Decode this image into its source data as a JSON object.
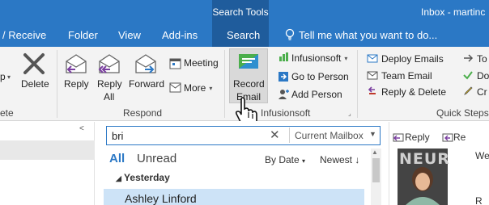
{
  "titlebar": {
    "context_group": "Search Tools",
    "window_title": "Inbox - martinc"
  },
  "menu": {
    "items": [
      "/ Receive",
      "Folder",
      "View",
      "Add-ins",
      "Search"
    ],
    "tell_me": "Tell me what you want to do..."
  },
  "ribbon": {
    "partial_left": "p",
    "delete_label": "Delete",
    "delete_group_partial": "ete",
    "respond": {
      "group": "Respond",
      "reply": "Reply",
      "reply_all_1": "Reply",
      "reply_all_2": "All",
      "forward": "Forward",
      "meeting": "Meeting",
      "more": "More"
    },
    "infusionsoft": {
      "group": "Infusionsoft",
      "record_1": "Record",
      "record_2": "Email",
      "infusionsoft_btn": "Infusionsoft",
      "go_to_person": "Go to Person",
      "add_person": "Add Person"
    },
    "quick_steps": {
      "group": "Quick Steps",
      "items": [
        "Deploy Emails",
        "Team Email",
        "Reply & Delete"
      ],
      "partial_items": [
        "To",
        "Do",
        "Cr"
      ]
    }
  },
  "search": {
    "value": "bri",
    "scope": "Current Mailbox"
  },
  "list": {
    "tab_all": "All",
    "tab_unread": "Unread",
    "sort": "By Date",
    "order": "Newest",
    "group_header": "Yesterday",
    "first_sender": "Ashley Linford"
  },
  "reading": {
    "reply": "Reply",
    "reply_all_partial": "Re",
    "photo_text": "NEUR",
    "partial_1": "We",
    "partial_2": "R"
  },
  "colors": {
    "titlebar": "#2b78c5",
    "context_tab": "#1f5c9c",
    "selection": "#cde3f7",
    "accent": "#2b78c5"
  }
}
